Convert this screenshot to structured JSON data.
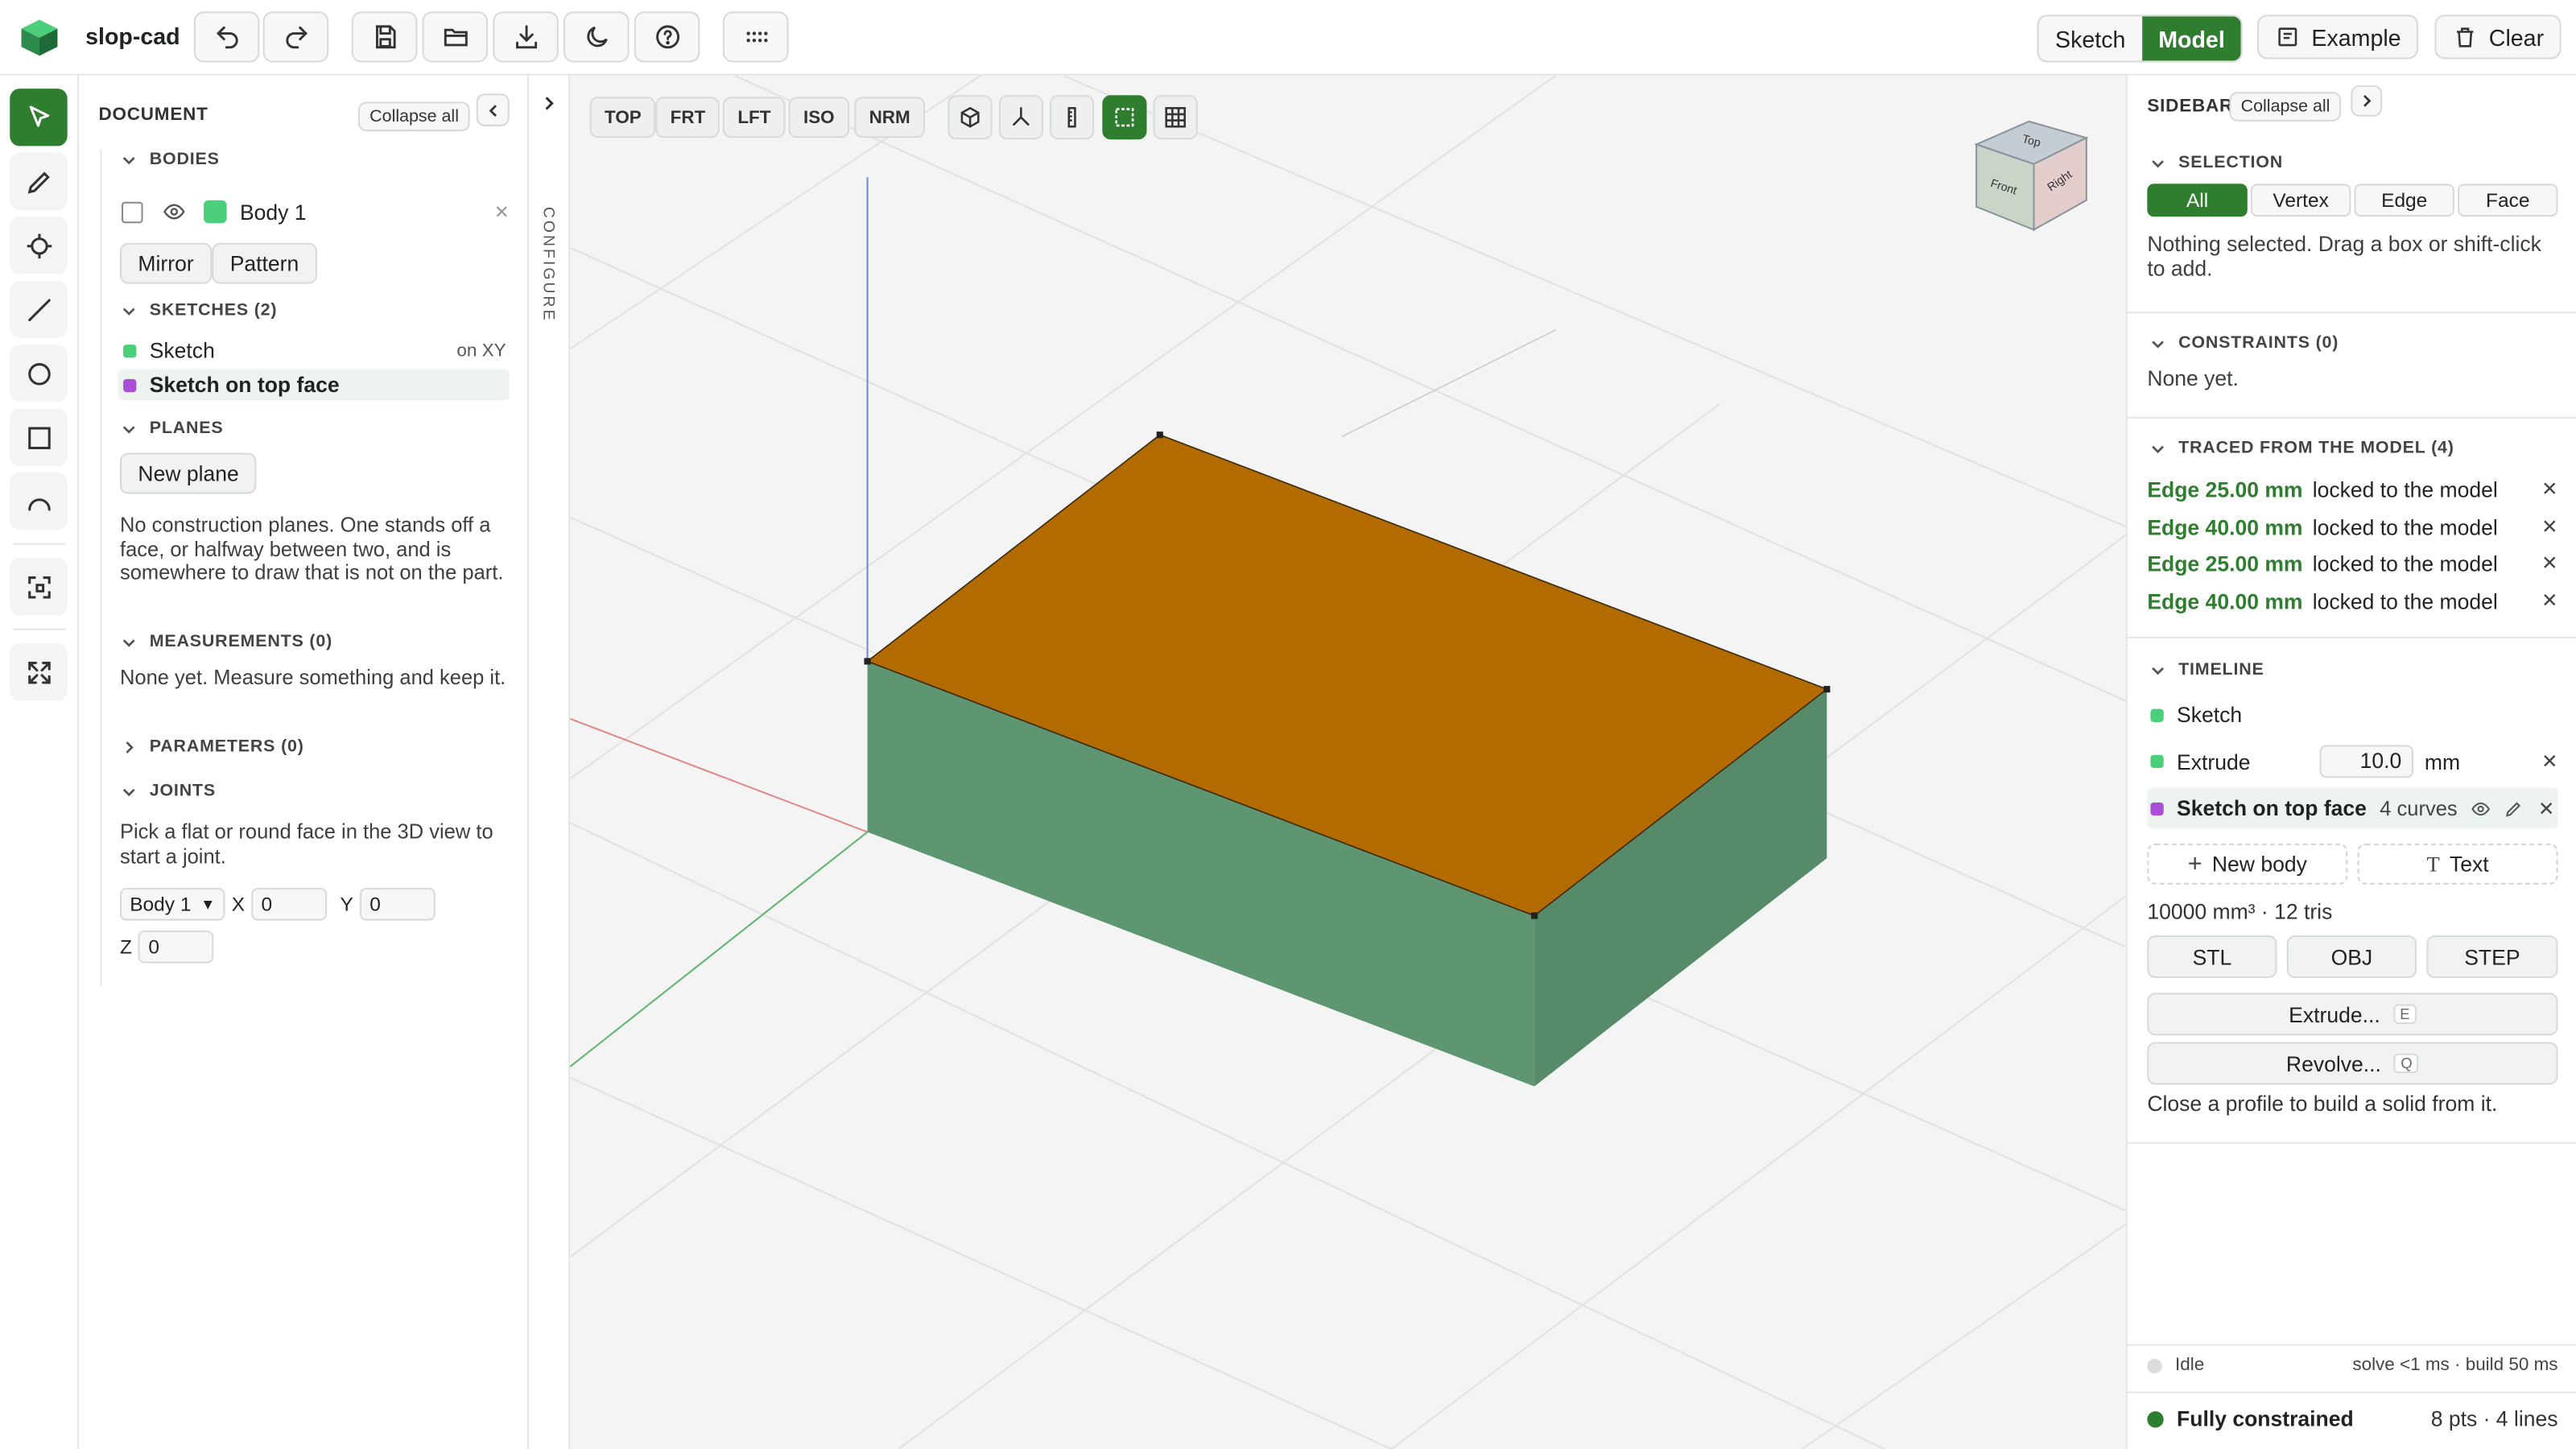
{
  "app": {
    "title": "slop-cad"
  },
  "header": {
    "mode_tabs": [
      {
        "label": "Sketch",
        "active": false
      },
      {
        "label": "Model",
        "active": true
      }
    ],
    "example_label": "Example",
    "clear_label": "Clear"
  },
  "document": {
    "title": "DOCUMENT",
    "collapse_all": "Collapse all",
    "bodies": {
      "header": "BODIES",
      "items": [
        {
          "name": "Body 1",
          "color": "#4ccf7a"
        }
      ],
      "mirror_label": "Mirror",
      "pattern_label": "Pattern"
    },
    "sketches": {
      "header": "SKETCHES (2)",
      "items": [
        {
          "name": "Sketch",
          "plane": "on XY",
          "color": "#4ccf7a"
        },
        {
          "name": "Sketch on top face",
          "plane": "",
          "color": "#a84fd6"
        }
      ]
    },
    "planes": {
      "header": "PLANES",
      "new_plane_label": "New plane",
      "description": "No construction planes. One stands off a face, or halfway between two, and is somewhere to draw that is not on the part."
    },
    "measurements": {
      "header": "MEASUREMENTS (0)",
      "description": "None yet. Measure something and keep it."
    },
    "parameters": {
      "header": "PARAMETERS (0)"
    },
    "joints": {
      "header": "JOINTS",
      "description": "Pick a flat or round face in the 3D view to start a joint.",
      "body_select": "Body 1",
      "x_label": "X",
      "x_value": "0",
      "y_label": "Y",
      "y_value": "0",
      "z_label": "Z",
      "z_value": "0"
    }
  },
  "configure": {
    "label": "CONFIGURE"
  },
  "viewport": {
    "view_buttons": [
      "TOP",
      "FRT",
      "LFT",
      "ISO",
      "NRM"
    ],
    "view_cube": {
      "top": "Top",
      "front": "Front",
      "right": "Right"
    },
    "colors": {
      "top_face": "#b36b00",
      "front_face": "#5f9672",
      "side_face": "#568a68"
    }
  },
  "sidebar": {
    "title": "SIDEBAR",
    "collapse_all": "Collapse all",
    "selection": {
      "header": "SELECTION",
      "filters": [
        {
          "label": "All",
          "active": true
        },
        {
          "label": "Vertex",
          "active": false
        },
        {
          "label": "Edge",
          "active": false
        },
        {
          "label": "Face",
          "active": false
        }
      ],
      "status": "Nothing selected. Drag a box or shift-click to add."
    },
    "constraints": {
      "header": "CONSTRAINTS (0)",
      "status": "None yet."
    },
    "traced": {
      "header": "TRACED FROM THE MODEL (4)",
      "items": [
        {
          "edge": "Edge 25.00 mm",
          "note": "locked to the model"
        },
        {
          "edge": "Edge 40.00 mm",
          "note": "locked to the model"
        },
        {
          "edge": "Edge 25.00 mm",
          "note": "locked to the model"
        },
        {
          "edge": "Edge 40.00 mm",
          "note": "locked to the model"
        }
      ]
    },
    "timeline": {
      "header": "TIMELINE",
      "items": [
        {
          "label": "Sketch",
          "color": "#4ccf7a"
        },
        {
          "label": "Extrude",
          "color": "#4ccf7a",
          "value": "10.0",
          "unit": "mm"
        },
        {
          "label": "Sketch on top face",
          "color": "#a84fd6",
          "detail": "4 curves"
        }
      ],
      "new_body": "New body",
      "text": "Text",
      "stats": "10000 mm³ · 12 tris",
      "exports": [
        "STL",
        "OBJ",
        "STEP"
      ],
      "extrude": "Extrude...",
      "extrude_key": "E",
      "revolve": "Revolve...",
      "revolve_key": "Q",
      "hint": "Close a profile to build a solid from it."
    },
    "status": {
      "idle": "Idle",
      "timing": "solve <1 ms · build 50 ms",
      "constraint_state": "Fully constrained",
      "counts": "8 pts · 4 lines"
    }
  },
  "accent": "#2f7d2f"
}
